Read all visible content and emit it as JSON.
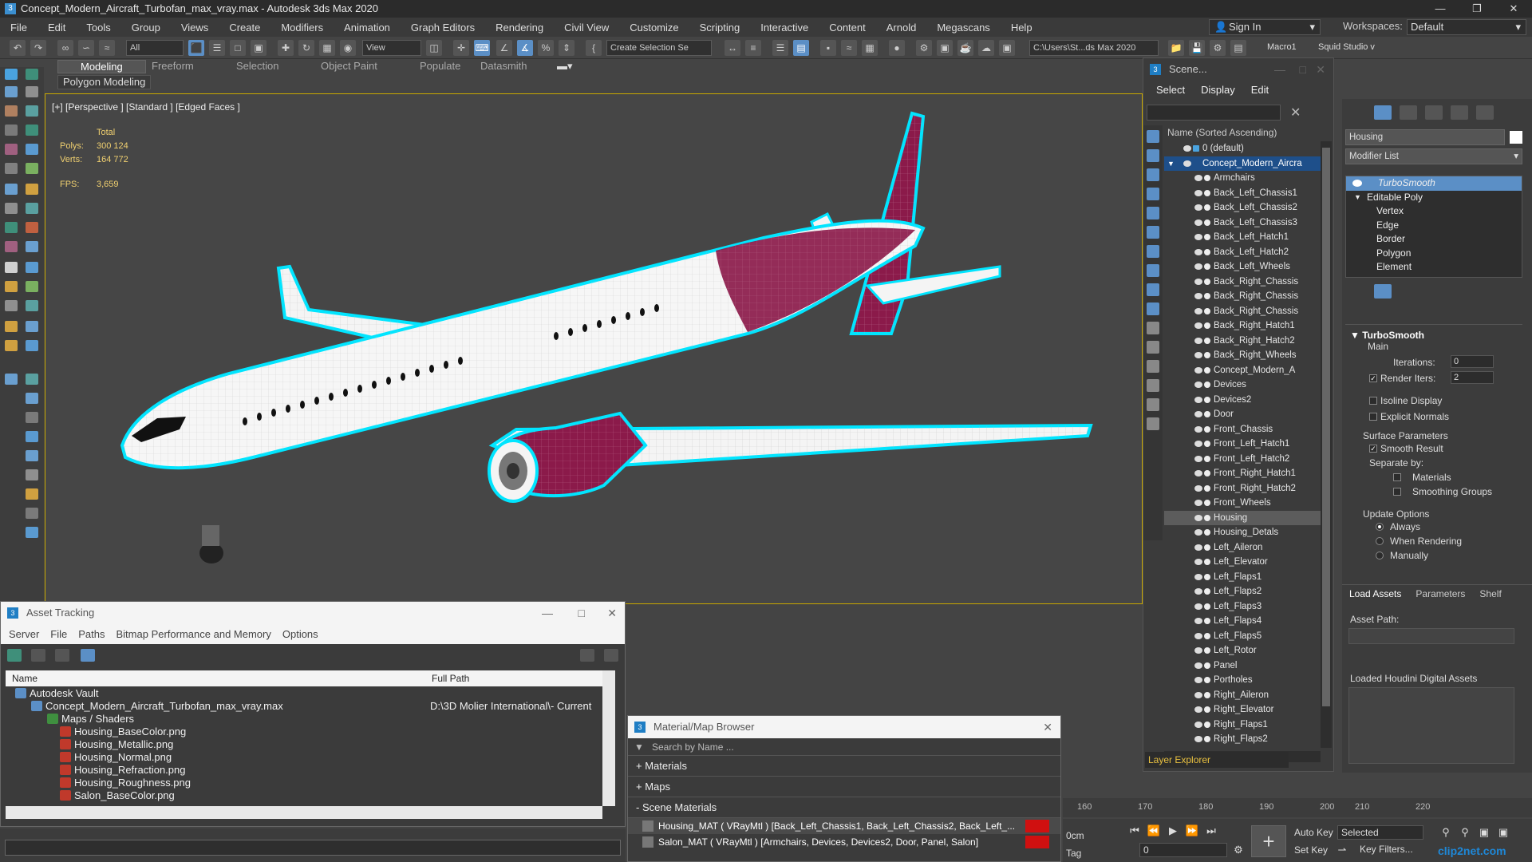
{
  "window": {
    "title": "Concept_Modern_Aircraft_Turbofan_max_vray.max - Autodesk 3ds Max 2020",
    "app_icon": "3"
  },
  "menu": [
    "File",
    "Edit",
    "Tools",
    "Group",
    "Views",
    "Create",
    "Modifiers",
    "Animation",
    "Graph Editors",
    "Rendering",
    "Civil View",
    "Customize",
    "Scripting",
    "Interactive",
    "Content",
    "Arnold",
    "Megascans",
    "Help"
  ],
  "account": {
    "sign_in": "Sign In",
    "workspaces_label": "Workspaces:",
    "workspace": "Default"
  },
  "toolbar": {
    "selection_filter": "All",
    "view": "View",
    "create_selection_set": "Create Selection Se",
    "path": "C:\\Users\\St...ds Max 2020",
    "macro": "Macro1",
    "squid": "Squid Studio v"
  },
  "ribbon": {
    "tabs": [
      "Modeling",
      "Freeform",
      "Selection",
      "Object Paint",
      "Populate",
      "Datasmith"
    ],
    "active_tab": "Modeling",
    "subtab": "Polygon Modeling"
  },
  "viewport": {
    "label": "[+] [Perspective ] [Standard ] [Edged Faces ]",
    "stats": {
      "total_label": "Total",
      "polys_label": "Polys:",
      "polys": "300 124",
      "verts_label": "Verts:",
      "verts": "164 772",
      "fps_label": "FPS:",
      "fps": "3,659"
    }
  },
  "scene_explorer": {
    "title": "Scene...",
    "menu": [
      "Select",
      "Display",
      "Edit"
    ],
    "column": "Name (Sorted Ascending)",
    "root_layer": "0 (default)",
    "root_object": "Concept_Modern_Aircra",
    "items": [
      "Armchairs",
      "Back_Left_Chassis1",
      "Back_Left_Chassis2",
      "Back_Left_Chassis3",
      "Back_Left_Hatch1",
      "Back_Left_Hatch2",
      "Back_Left_Wheels",
      "Back_Right_Chassis",
      "Back_Right_Chassis",
      "Back_Right_Chassis",
      "Back_Right_Hatch1",
      "Back_Right_Hatch2",
      "Back_Right_Wheels",
      "Concept_Modern_A",
      "Devices",
      "Devices2",
      "Door",
      "Front_Chassis",
      "Front_Left_Hatch1",
      "Front_Left_Hatch2",
      "Front_Right_Hatch1",
      "Front_Right_Hatch2",
      "Front_Wheels",
      "Housing",
      "Housing_Detals",
      "Left_Aileron",
      "Left_Elevator",
      "Left_Flaps1",
      "Left_Flaps2",
      "Left_Flaps3",
      "Left_Flaps4",
      "Left_Flaps5",
      "Left_Rotor",
      "Panel",
      "Portholes",
      "Right_Aileron",
      "Right_Elevator",
      "Right_Flaps1",
      "Right_Flaps2"
    ],
    "selected_item": "Housing",
    "footer": "Layer Explorer"
  },
  "command_panel": {
    "object_name": "Housing",
    "modifier_list": "Modifier List",
    "stack": [
      "TurboSmooth",
      "Editable Poly",
      "Vertex",
      "Edge",
      "Border",
      "Polygon",
      "Element"
    ],
    "rollout_title": "TurboSmooth",
    "main_label": "Main",
    "iterations_label": "Iterations:",
    "iterations": "0",
    "render_iters_label": "Render Iters:",
    "render_iters": "2",
    "isoline": "Isoline Display",
    "explicit_normals": "Explicit Normals",
    "surface_params": "Surface Parameters",
    "smooth_result": "Smooth Result",
    "separate_by": "Separate by:",
    "materials": "Materials",
    "smoothing_groups": "Smoothing Groups",
    "update_options": "Update Options",
    "always": "Always",
    "when_rendering": "When Rendering",
    "manually": "Manually"
  },
  "houdini_panel": {
    "tabs": [
      "Load Assets",
      "Parameters",
      "Shelf"
    ],
    "asset_path_label": "Asset Path:",
    "loaded_label": "Loaded Houdini Digital Assets"
  },
  "asset_tracking": {
    "title": "Asset Tracking",
    "menu": [
      "Server",
      "File",
      "Paths",
      "Bitmap Performance and Memory",
      "Options"
    ],
    "col_name": "Name",
    "col_path": "Full Path",
    "rows": [
      {
        "name": "Autodesk Vault",
        "path": ""
      },
      {
        "name": "Concept_Modern_Aircraft_Turbofan_max_vray.max",
        "path": "D:\\3D Molier International\\- Current"
      },
      {
        "name": "Maps / Shaders",
        "path": ""
      },
      {
        "name": "Housing_BaseColor.png",
        "path": ""
      },
      {
        "name": "Housing_Metallic.png",
        "path": ""
      },
      {
        "name": "Housing_Normal.png",
        "path": ""
      },
      {
        "name": "Housing_Refraction.png",
        "path": ""
      },
      {
        "name": "Housing_Roughness.png",
        "path": ""
      },
      {
        "name": "Salon_BaseColor.png",
        "path": ""
      }
    ]
  },
  "material_browser": {
    "title": "Material/Map Browser",
    "search_placeholder": "Search by Name ...",
    "categories": [
      "+ Materials",
      "+ Maps",
      "- Scene Materials"
    ],
    "materials": [
      "Housing_MAT  ( VRayMtl )  [Back_Left_Chassis1, Back_Left_Chassis2, Back_Left_...",
      "Salon_MAT  ( VRayMtl )  [Armchairs, Devices, Devices2, Door, Panel, Salon]"
    ]
  },
  "timeline": {
    "ticks": [
      "160",
      "170",
      "180",
      "190",
      "200",
      "210",
      "220"
    ]
  },
  "playback": {
    "time": "0cm",
    "tag": "Tag",
    "frame": "0",
    "auto_key": "Auto Key",
    "set_key": "Set Key",
    "selected": "Selected",
    "key_filters": "Key Filters..."
  },
  "watermark": "clip2net.com",
  "colors": {
    "accent": "#5b8fc6",
    "selection_highlight": "#00ffff",
    "livery": "#8b1a4a",
    "viewport_border": "#c9a800"
  }
}
